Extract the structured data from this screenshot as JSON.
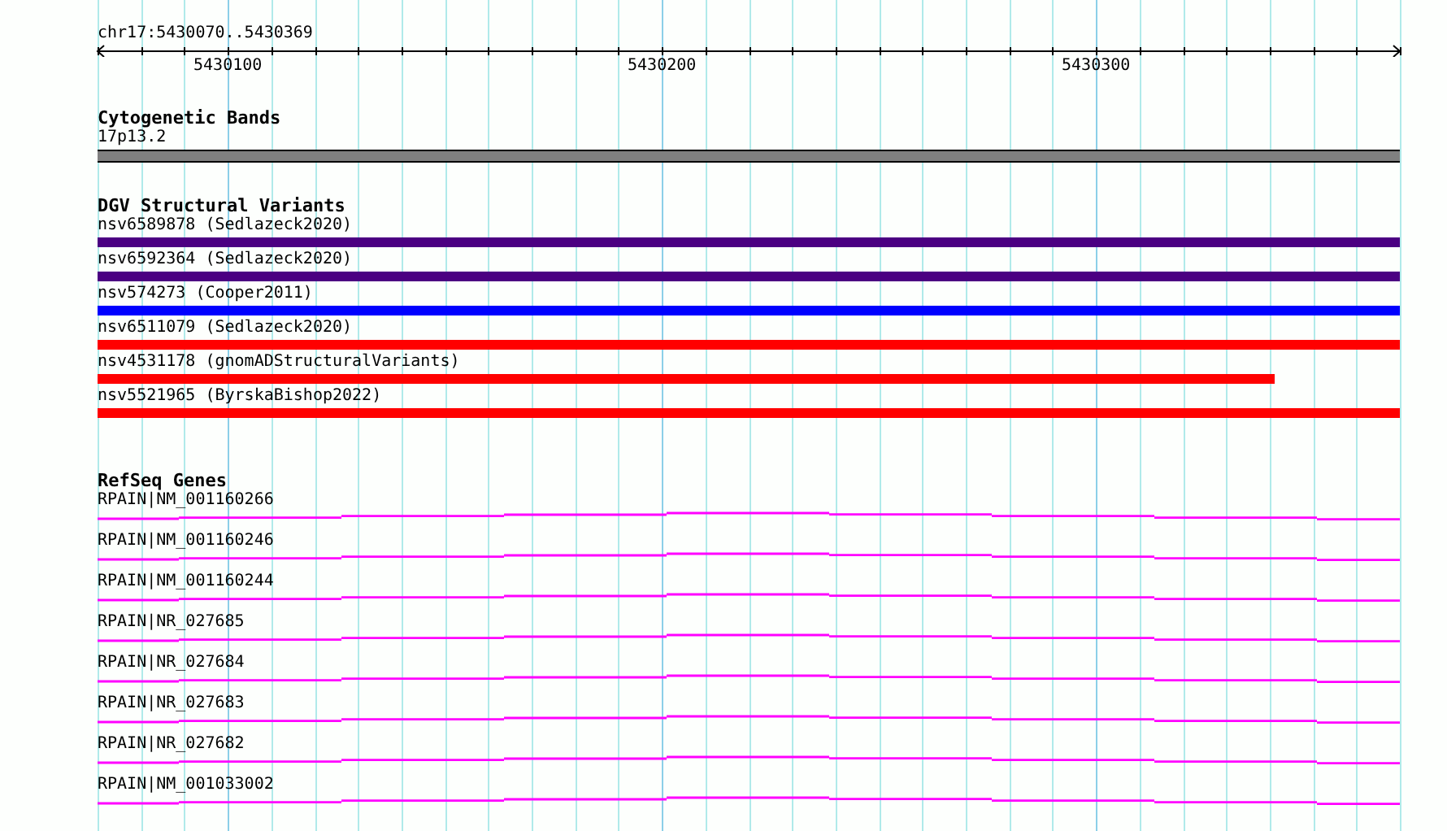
{
  "ruler": {
    "range": "chr17:5430070..5430369",
    "tick_labels": [
      "5430100",
      "5430200",
      "5430300"
    ]
  },
  "cytogenetic_bands": {
    "title": "Cytogenetic Bands",
    "bands": [
      {
        "label": "17p13.2"
      }
    ]
  },
  "dgv_structural_variants": {
    "title": "DGV Structural Variants",
    "variants": [
      {
        "label": "nsv6589878 (Sedlazeck2020)",
        "color": "#4b0082",
        "extends_past_view": true
      },
      {
        "label": "nsv6592364 (Sedlazeck2020)",
        "color": "#4b0082",
        "extends_past_view": true
      },
      {
        "label": "nsv574273 (Cooper2011)",
        "color": "#0000ff",
        "extends_past_view": true
      },
      {
        "label": "nsv6511079 (Sedlazeck2020)",
        "color": "#ff0000",
        "extends_past_view": true
      },
      {
        "label": "nsv4531178 (gnomADStructuralVariants)",
        "color": "#ff0000",
        "extends_past_view": false
      },
      {
        "label": "nsv5521965 (ByrskaBishop2022)",
        "color": "#ff0000",
        "extends_past_view": true
      }
    ]
  },
  "refseq_genes": {
    "title": "RefSeq Genes",
    "genes": [
      {
        "label": "RPAIN|NM_001160266"
      },
      {
        "label": "RPAIN|NM_001160246"
      },
      {
        "label": "RPAIN|NM_001160244"
      },
      {
        "label": "RPAIN|NR_027685"
      },
      {
        "label": "RPAIN|NR_027684"
      },
      {
        "label": "RPAIN|NR_027683"
      },
      {
        "label": "RPAIN|NR_027682"
      },
      {
        "label": "RPAIN|NM_001033002"
      }
    ]
  }
}
